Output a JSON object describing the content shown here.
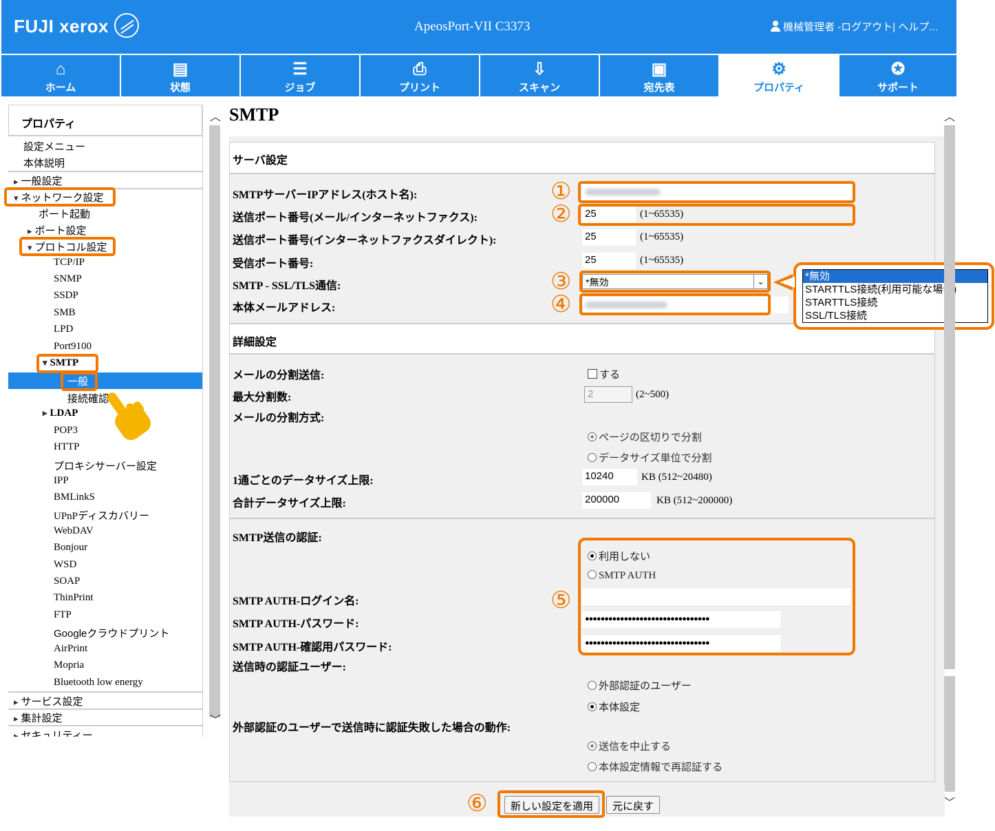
{
  "header": {
    "brand": "FUJI xerox",
    "model": "ApeosPort-VII C3373",
    "user": "機械管理者",
    "user_links": "-ログアウト| ヘルプ..."
  },
  "nav": [
    {
      "label": "ホーム",
      "icon": "home-icon",
      "glyph": "⌂"
    },
    {
      "label": "状態",
      "icon": "status-icon",
      "glyph": "▤"
    },
    {
      "label": "ジョブ",
      "icon": "job-icon",
      "glyph": "☰"
    },
    {
      "label": "プリント",
      "icon": "print-icon",
      "glyph": "⎙"
    },
    {
      "label": "スキャン",
      "icon": "scan-icon",
      "glyph": "⇩"
    },
    {
      "label": "宛先表",
      "icon": "address-book-icon",
      "glyph": "▣"
    },
    {
      "label": "プロパティ",
      "icon": "properties-icon",
      "glyph": "⚙"
    },
    {
      "label": "サポート",
      "icon": "support-icon",
      "glyph": "✪"
    }
  ],
  "sidebar": {
    "title": "プロパティ",
    "items": {
      "settings_menu": "設定メニュー",
      "device_desc": "本体説明",
      "general": "一般設定",
      "network": "ネットワーク設定",
      "port_start": "ポート起動",
      "port_settings": "ポート設定",
      "protocol": "プロトコル設定",
      "tcpip": "TCP/IP",
      "snmp": "SNMP",
      "ssdp": "SSDP",
      "smb": "SMB",
      "lpd": "LPD",
      "port9100": "Port9100",
      "smtp": "SMTP",
      "smtp_general": "一般",
      "smtp_conn": "接続確認",
      "ldap": "LDAP",
      "pop3": "POP3",
      "http": "HTTP",
      "proxy": "プロキシサーバー設定",
      "ipp": "IPP",
      "bmlinks": "BMLinkS",
      "upnp": "UPnPディスカバリー",
      "webdav": "WebDAV",
      "bonjour": "Bonjour",
      "wsd": "WSD",
      "soap": "SOAP",
      "thinprint": "ThinPrint",
      "ftp": "FTP",
      "google": "Googleクラウドプリント",
      "airprint": "AirPrint",
      "mopria": "Mopria",
      "ble": "Bluetooth low energy",
      "service": "サービス設定",
      "accounting": "集計設定",
      "security": "セキュリティー"
    }
  },
  "page": {
    "title": "SMTP",
    "server_section": "サーバ設定",
    "detail_section": "詳細設定",
    "fields": {
      "smtp_ip_label": "SMTPサーバーIPアドレス(ホスト名):",
      "send_port_mail_label": "送信ポート番号(メール/インターネットファクス):",
      "send_port_mail_value": "25",
      "send_port_mail_range": "(1~65535)",
      "send_port_direct_label": "送信ポート番号(インターネットファクスダイレクト):",
      "send_port_direct_value": "25",
      "send_port_direct_range": "(1~65535)",
      "recv_port_label": "受信ポート番号:",
      "recv_port_value": "25",
      "recv_port_range": "(1~65535)",
      "ssl_label": "SMTP - SSL/TLS通信:",
      "ssl_value": "*無効",
      "mail_addr_label": "本体メールアドレス:",
      "split_label": "メールの分割送信:",
      "split_check": "する",
      "max_split_label": "最大分割数:",
      "max_split_value": "2",
      "max_split_range": "(2~500)",
      "split_method_label": "メールの分割方式:",
      "split_page": "ページの区切りで分割",
      "split_size": "データサイズ単位で分割",
      "per_mail_label": "1通ごとのデータサイズ上限:",
      "per_mail_value": "10240",
      "per_mail_range": "KB (512~20480)",
      "total_label": "合計データサイズ上限:",
      "total_value": "200000",
      "total_range": "KB (512~200000)",
      "auth_label": "SMTP送信の認証:",
      "auth_none": "利用しない",
      "auth_smtp": "SMTP AUTH",
      "login_label": "SMTP AUTH-ログイン名:",
      "password_label": "SMTP AUTH-パスワード:",
      "password_value": "●●●●●●●●●●●●●●●●●●●●●●●●●●●●●●●●",
      "confirm_label": "SMTP AUTH-確認用パスワード:",
      "confirm_value": "●●●●●●●●●●●●●●●●●●●●●●●●●●●●●●●●",
      "auth_user_label": "送信時の認証ユーザー:",
      "auth_user_ext": "外部認証のユーザー",
      "auth_user_dev": "本体設定",
      "fail_label": "外部認証のユーザーで送信時に認証失敗した場合の動作:",
      "fail_stop": "送信を中止する",
      "fail_reauth": "本体設定情報で再認証する"
    },
    "dropdown_options": [
      "*無効",
      "STARTTLS接続(利用可能な場合)",
      "STARTTLS接続",
      "SSL/TLS接続"
    ],
    "apply_button": "新しい設定を適用",
    "revert_button": "元に戻す"
  },
  "callouts": [
    "①",
    "②",
    "③",
    "④",
    "⑤",
    "⑥"
  ],
  "colors": {
    "brand_blue": "#1f87e5",
    "highlight_orange": "#f07800",
    "selected_blue": "#1f6fd0"
  }
}
